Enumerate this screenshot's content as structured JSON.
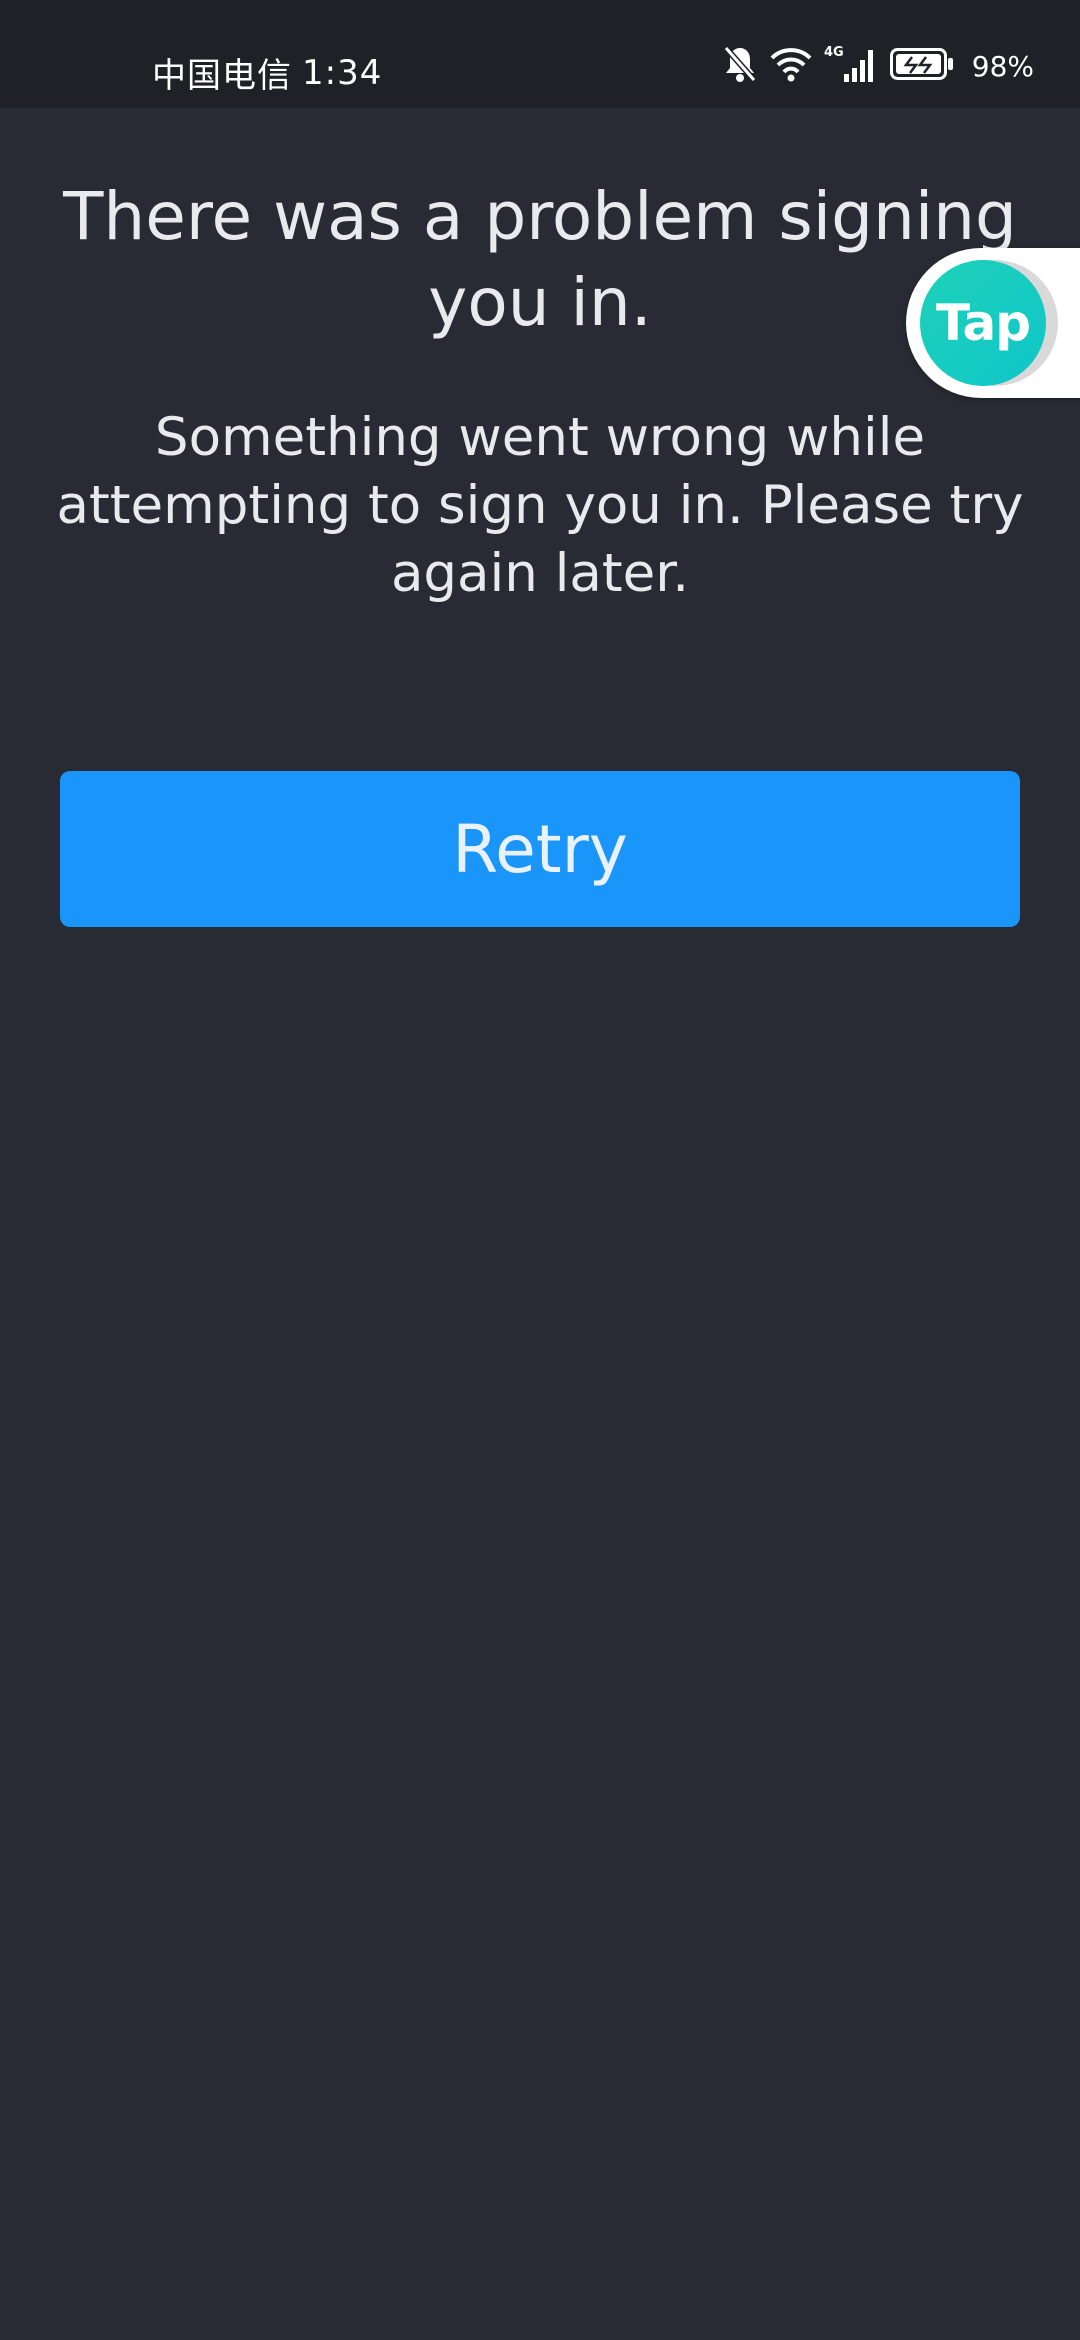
{
  "status_bar": {
    "carrier": "中国电信",
    "time": "1:34",
    "network": "4G",
    "battery_percent": "98%",
    "icons": [
      "bell-muted-icon",
      "wifi-icon",
      "signal-icon",
      "battery-icon"
    ]
  },
  "error": {
    "title": "There was a problem signing you in.",
    "message": "Something went wrong while attempting to sign you in. Please try again later."
  },
  "actions": {
    "retry_label": "Retry"
  },
  "floating": {
    "tap_label": "Tap"
  },
  "colors": {
    "background": "#282b33",
    "status_bar": "#202126",
    "button": "#1a95fa",
    "text": "#e8eaee",
    "tap_accent": "#1fd1b8"
  }
}
